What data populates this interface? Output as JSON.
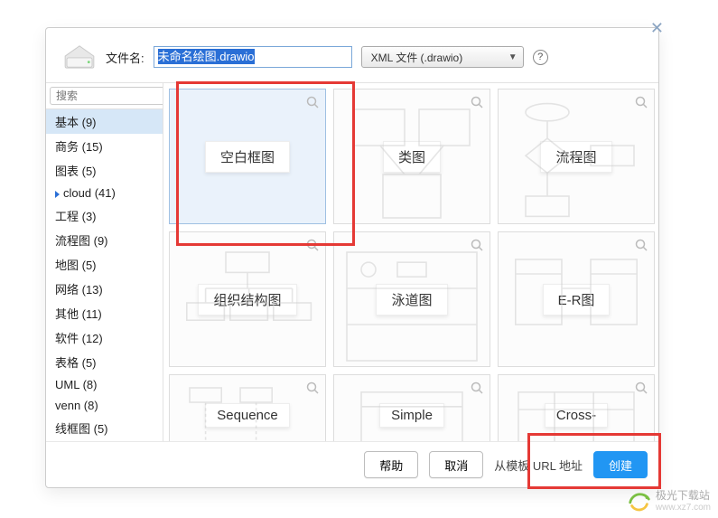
{
  "header": {
    "filename_label": "文件名:",
    "filename_value": "未命名绘图.drawio",
    "format_selected": "XML 文件 (.drawio)",
    "help_glyph": "?"
  },
  "search": {
    "placeholder": "搜索"
  },
  "categories": [
    {
      "label": "基本 (9)",
      "selected": true,
      "indent": false
    },
    {
      "label": "商务 (15)",
      "selected": false,
      "indent": false
    },
    {
      "label": "图表 (5)",
      "selected": false,
      "indent": false
    },
    {
      "label": "cloud (41)",
      "selected": false,
      "indent": true
    },
    {
      "label": "工程 (3)",
      "selected": false,
      "indent": false
    },
    {
      "label": "流程图 (9)",
      "selected": false,
      "indent": false
    },
    {
      "label": "地图 (5)",
      "selected": false,
      "indent": false
    },
    {
      "label": "网络 (13)",
      "selected": false,
      "indent": false
    },
    {
      "label": "其他 (11)",
      "selected": false,
      "indent": false
    },
    {
      "label": "软件 (12)",
      "selected": false,
      "indent": false
    },
    {
      "label": "表格 (5)",
      "selected": false,
      "indent": false
    },
    {
      "label": "UML (8)",
      "selected": false,
      "indent": false
    },
    {
      "label": "venn (8)",
      "selected": false,
      "indent": false
    },
    {
      "label": "线框图 (5)",
      "selected": false,
      "indent": false
    }
  ],
  "templates": {
    "row1": [
      {
        "label": "空白框图",
        "selected": true
      },
      {
        "label": "类图",
        "selected": false
      },
      {
        "label": "流程图",
        "selected": false
      }
    ],
    "row2": [
      {
        "label": "组织结构图"
      },
      {
        "label": "泳道图"
      },
      {
        "label": "E-R图"
      }
    ],
    "row3": [
      {
        "label": "Sequence"
      },
      {
        "label": "Simple"
      },
      {
        "label": "Cross-"
      }
    ]
  },
  "footer": {
    "help": "帮助",
    "cancel": "取消",
    "from_url": "从模板 URL 地址",
    "create": "创建"
  },
  "watermark": {
    "text": "极光下载站",
    "url": "www.xz7.com"
  },
  "icons": {
    "magnify": "search-icon",
    "chevron": "chevron-down-icon",
    "close": "close-icon"
  }
}
